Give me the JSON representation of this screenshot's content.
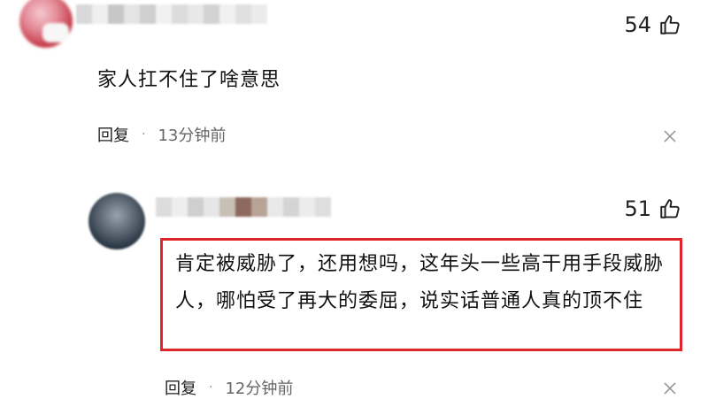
{
  "comments": [
    {
      "likes": "54",
      "text": "家人扛不住了啥意思",
      "reply_label": "回复",
      "separator": "·",
      "time": "13分钟前"
    },
    {
      "likes": "51",
      "text": "肯定被威胁了，还用想吗，这年头一些高干用手段威胁人，哪怕受了再大的委屈，说实话普通人真的顶不住",
      "reply_label": "回复",
      "separator": "·",
      "time": "12分钟前"
    }
  ],
  "colors": {
    "highlight_border": "#e0262b",
    "text": "#111111",
    "meta": "#666666"
  },
  "icons": {
    "like": "thumbs-up-icon",
    "dismiss": "close-icon"
  }
}
